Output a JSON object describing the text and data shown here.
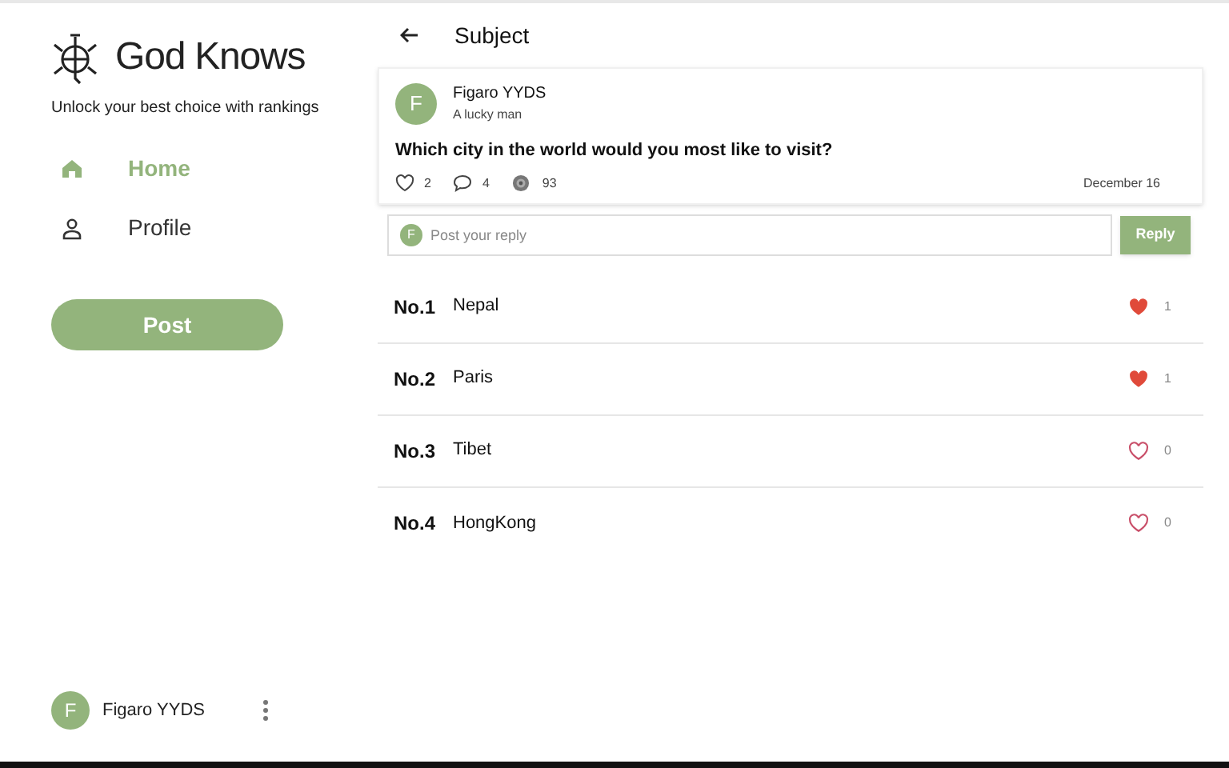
{
  "sidebar": {
    "brand": {
      "title": "God Knows",
      "tagline": "Unlock your best choice with rankings"
    },
    "nav": [
      {
        "label": "Home",
        "selected": true
      },
      {
        "label": "Profile",
        "selected": false
      }
    ],
    "post_button": "Post",
    "account": {
      "avatar": "F",
      "name": "Figaro YYDS"
    }
  },
  "header": {
    "title": "Subject"
  },
  "post": {
    "avatar": "F",
    "author": "Figaro YYDS",
    "bio": "A lucky man",
    "question": "Which city in the world would you most like to visit?",
    "likes": "2",
    "comments": "4",
    "views": "93",
    "date": "December 16"
  },
  "reply": {
    "avatar": "F",
    "placeholder": "Post your reply",
    "button": "Reply"
  },
  "rankings": [
    {
      "rank": "No.1",
      "name": "Nepal",
      "liked": true,
      "count": "1"
    },
    {
      "rank": "No.2",
      "name": "Paris",
      "liked": true,
      "count": "1"
    },
    {
      "rank": "No.3",
      "name": "Tibet",
      "liked": false,
      "count": "0"
    },
    {
      "rank": "No.4",
      "name": "HongKong",
      "liked": false,
      "count": "0"
    }
  ]
}
